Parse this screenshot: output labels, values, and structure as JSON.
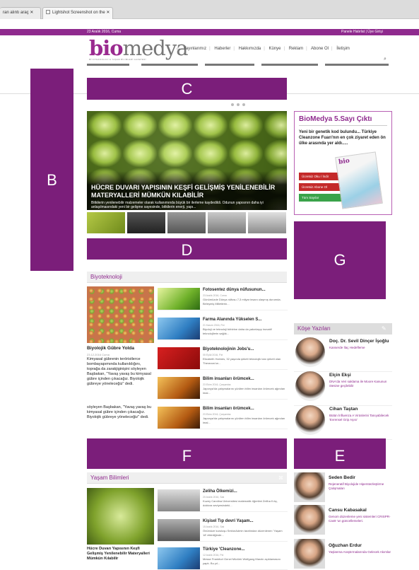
{
  "browser": {
    "tabs": [
      {
        "label": "ran alıntı araç ✕"
      },
      {
        "label": "Lightshot Screenshot on the ✕"
      }
    ]
  },
  "site": {
    "date": "23 Aralık 2016, Cuma",
    "top_links": "Panele Hatırlat  |  Üye Girişi",
    "logo_bio": "bio",
    "logo_medya": "medya",
    "tagline": "BİYOTEKNOLOJİ & YAŞAM BİLİMLERİ GAZETESİ",
    "nav": [
      "Yayınlarımız",
      "Haberler",
      "Hakkımızda",
      "Künye",
      "Reklam",
      "Abone Ol",
      "İletişim"
    ]
  },
  "overlays": {
    "b": "B",
    "c": "C",
    "d": "D",
    "g": "G",
    "f": "F",
    "e": "E"
  },
  "slider": {
    "title": "HÜCRE DUVARI YAPISININ KEŞFİ GELİŞMİŞ YENİLENEBİLİR MATERYALLERİ MÜMKÜN KILABİLİR",
    "desc": "Bitkilerin yenilenebilir malzemeler olarak kullanımında büyük bir ilerleme kaydedildi. Odunun yapısının daha iyi anlaşılmasındaki yeni bir gelişme sayesinde, bitkilerin enerji, yapı..."
  },
  "promo": {
    "title": "BioMedya 5.Sayı Çıktı",
    "desc": "Yeni bir genetik kod bulundu... Türkiye Cleanzone Fuarı'nın en çok ziyaret eden ön ülke arasında yer aldı.....",
    "btn1": "Ücretsiz Oku / İndir",
    "btn2": "Ücretsiz Abone Ol",
    "btn3": "Tüm Sayılar",
    "mag": "bio"
  },
  "biotech": {
    "heading": "Biyoteknoloji",
    "feature_title": "Biyolojik Gübre Yolda",
    "feature_meta": "23.12.2016 Cuma",
    "feature_desc": "Kimyasal gübrenin teröristlerce bombayapımında kullanıldığını, toprağa da zarakjiginişini söyleyen Başbakan, \"Yavaş yavaş bu kimyasal gübre içinden çıkacağız. Biyolojik gübreye yöneleceğiz\" dedi.",
    "feature_desc2": "söyleyen Başbakan, \"Yavaş yavaş bu kimyasal gübre içinden çıkacağız. Biyolojik gübreye yöneleceğiz\" dedi.",
    "articles": [
      {
        "title": "Fotosentez dünya nüfusunun...",
        "meta": "23 Aralık 2016, Cuma",
        "desc": "Günümüzde Dünya nüfusu 7,3 milyar insanı ulaşmış durumda. Birleşmiş Milletlerin..."
      },
      {
        "title": "Farma Alanında Yükselen S...",
        "meta": "21 Kasım 2016, Pzt",
        "desc": "Biyoloji ve teknoloji birbirine daha da yakınlaşıp inovatif teknolojilerin sağlık..."
      },
      {
        "title": "Biyoteknolojinin Jobs'u...",
        "meta": "05 Eylül 2016, Pzt",
        "desc": "Elizabeth Holmes, 32 yaşında şirketi teknolojik tanı şirketi olan Theranos'un..."
      },
      {
        "title": "Bilim insanları örümcek...",
        "meta": "23 Ekim 2016, Çarşamba",
        "desc": "Japonya'da çalışmalarını yürüten bilim insanları örümcek ağından imal..."
      },
      {
        "title": "Bilim insanları örümcek...",
        "meta": "23 Ekim 2016, Çarşamba",
        "desc": "Japonya'da çalışmalarını yürüten bilim insanları örümcek ağından imal..."
      }
    ]
  },
  "columns": {
    "heading": "Köşe Yazıları",
    "authors": [
      {
        "name": "Doç. Dr. Sevil Dinçer İşoğlu",
        "desc": "Kanserde İlaç Hedefleme"
      },
      {
        "name": "Elçin Ekşi",
        "desc": "DNA'da Veri saklama ile Moore Kanunun ötesine geçilebilir"
      },
      {
        "name": "Cihan Taştan",
        "desc": "Bütün İnfluenza A Virüslerini Tanıyabilecek 'Evrensel Grip Aşısı'"
      }
    ]
  },
  "life": {
    "heading": "Yaşam Bilimleri",
    "feature_title": "Hücre Duvarı Yapısının Keşfi Gelişmiş Yenilenebilir Materyalleri Mümkün Kılabilir",
    "articles": [
      {
        "title": "Zeliha Ölkemizi...",
        "meta": "20 Aralık 2016, Salı",
        "desc": "Kuzey Carolina Üniversitesi matematik öğretimi Zeliha Kılıç, doktora seviyesindeki..."
      },
      {
        "title": "Kişisel Tıp devri Yaşam...",
        "meta": "15 Aralık 2016, Salı",
        "desc": "Önümüze kuruluşu SektorAdmin tarafından düzenlenen 'Yaşam 18' etkinliğinde..."
      },
      {
        "title": "Türkiye 'Cleanzone...",
        "meta": "12 Aralık 2016, Pzt",
        "desc": "Messe Frankfurt Genel Müdürü Wolfgang Marzin açıklamasını yaptı. Bu yıl..."
      }
    ]
  },
  "sidebar_people": [
    {
      "name": "Seden Bedir",
      "desc": "Rejeneratif Biyolojide Hiperstezleştirme Çalışmaları"
    },
    {
      "name": "Cansu Kabasakal",
      "desc": "Genom düzenleme yeni sistemleri CRISPR-Cas9 'un güncellemeleri."
    },
    {
      "name": "Oğuzhan Erdur",
      "desc": "Yaşlanma Araştırmalarında Gelecek Akımlar"
    }
  ]
}
